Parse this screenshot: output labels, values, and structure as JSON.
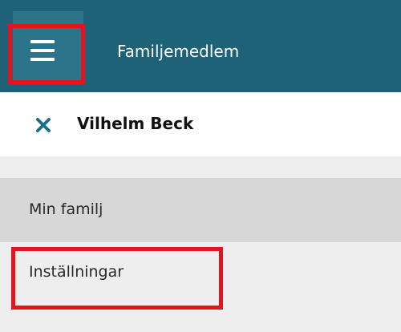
{
  "header": {
    "title": "Familjemedlem",
    "menu_icon": "hamburger-icon",
    "background": "#1d6277"
  },
  "subheader": {
    "close_icon": "close-icon",
    "person_name": "Vilhelm Beck"
  },
  "nav": {
    "items": [
      {
        "label": "Min familj",
        "selected": true
      },
      {
        "label": "Inställningar",
        "selected": false
      }
    ]
  },
  "highlight_color": "#e3141e"
}
